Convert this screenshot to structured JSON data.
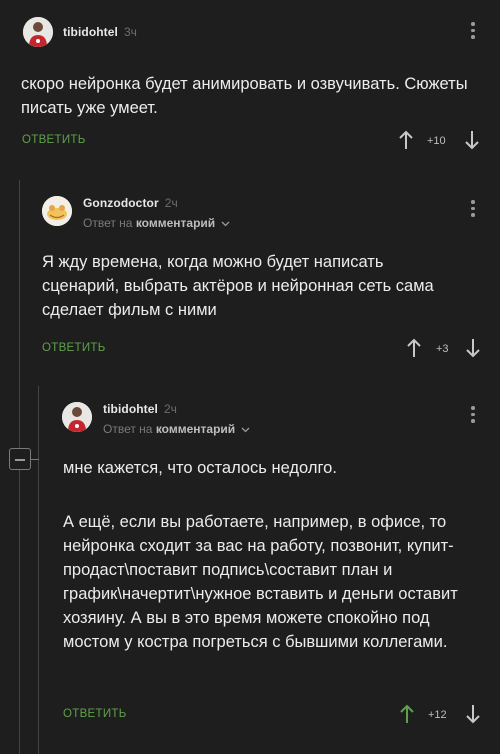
{
  "comments": [
    {
      "username": "tibidohtel",
      "time": "3ч",
      "text": "скоро нейронка будет анимировать и озвучивать. Сюжеты писать уже умеет.",
      "reply_label": "ОТВЕТИТЬ",
      "rating": "+10"
    },
    {
      "username": "Gonzodoctor",
      "time": "2ч",
      "reply_to_prefix": "Ответ на",
      "reply_to_target": "комментарий",
      "text": "Я жду времена, когда можно будет написать сценарий, выбрать актёров и нейронная сеть сама сделает фильм с ними",
      "reply_label": "ОТВЕТИТЬ",
      "rating": "+3"
    },
    {
      "username": "tibidohtel",
      "time": "2ч",
      "reply_to_prefix": "Ответ на",
      "reply_to_target": "комментарий",
      "text_p1": "мне кажется, что осталось недолго.",
      "text_p2": "А ещё, если вы работаете, например, в офисе, то нейронка сходит за вас на работу, позвонит, купит-продаст\\поставит подпись\\составит план и график\\начертит\\нужное вставить и деньги оставит хозяину. А вы в это время можете спокойно под мостом у костра погреться с бывшими коллегами.",
      "reply_label": "ОТВЕТИТЬ",
      "rating": "+12"
    }
  ],
  "colors": {
    "background": "#1e1e1f",
    "accent_green": "#5fa14a",
    "text": "#ececec",
    "muted": "#6d6d6d"
  },
  "icons": [
    "avatar",
    "kebab-menu-icon",
    "upvote-arrow-icon",
    "downvote-arrow-icon",
    "chevron-down-icon",
    "collapse-thread-icon"
  ]
}
